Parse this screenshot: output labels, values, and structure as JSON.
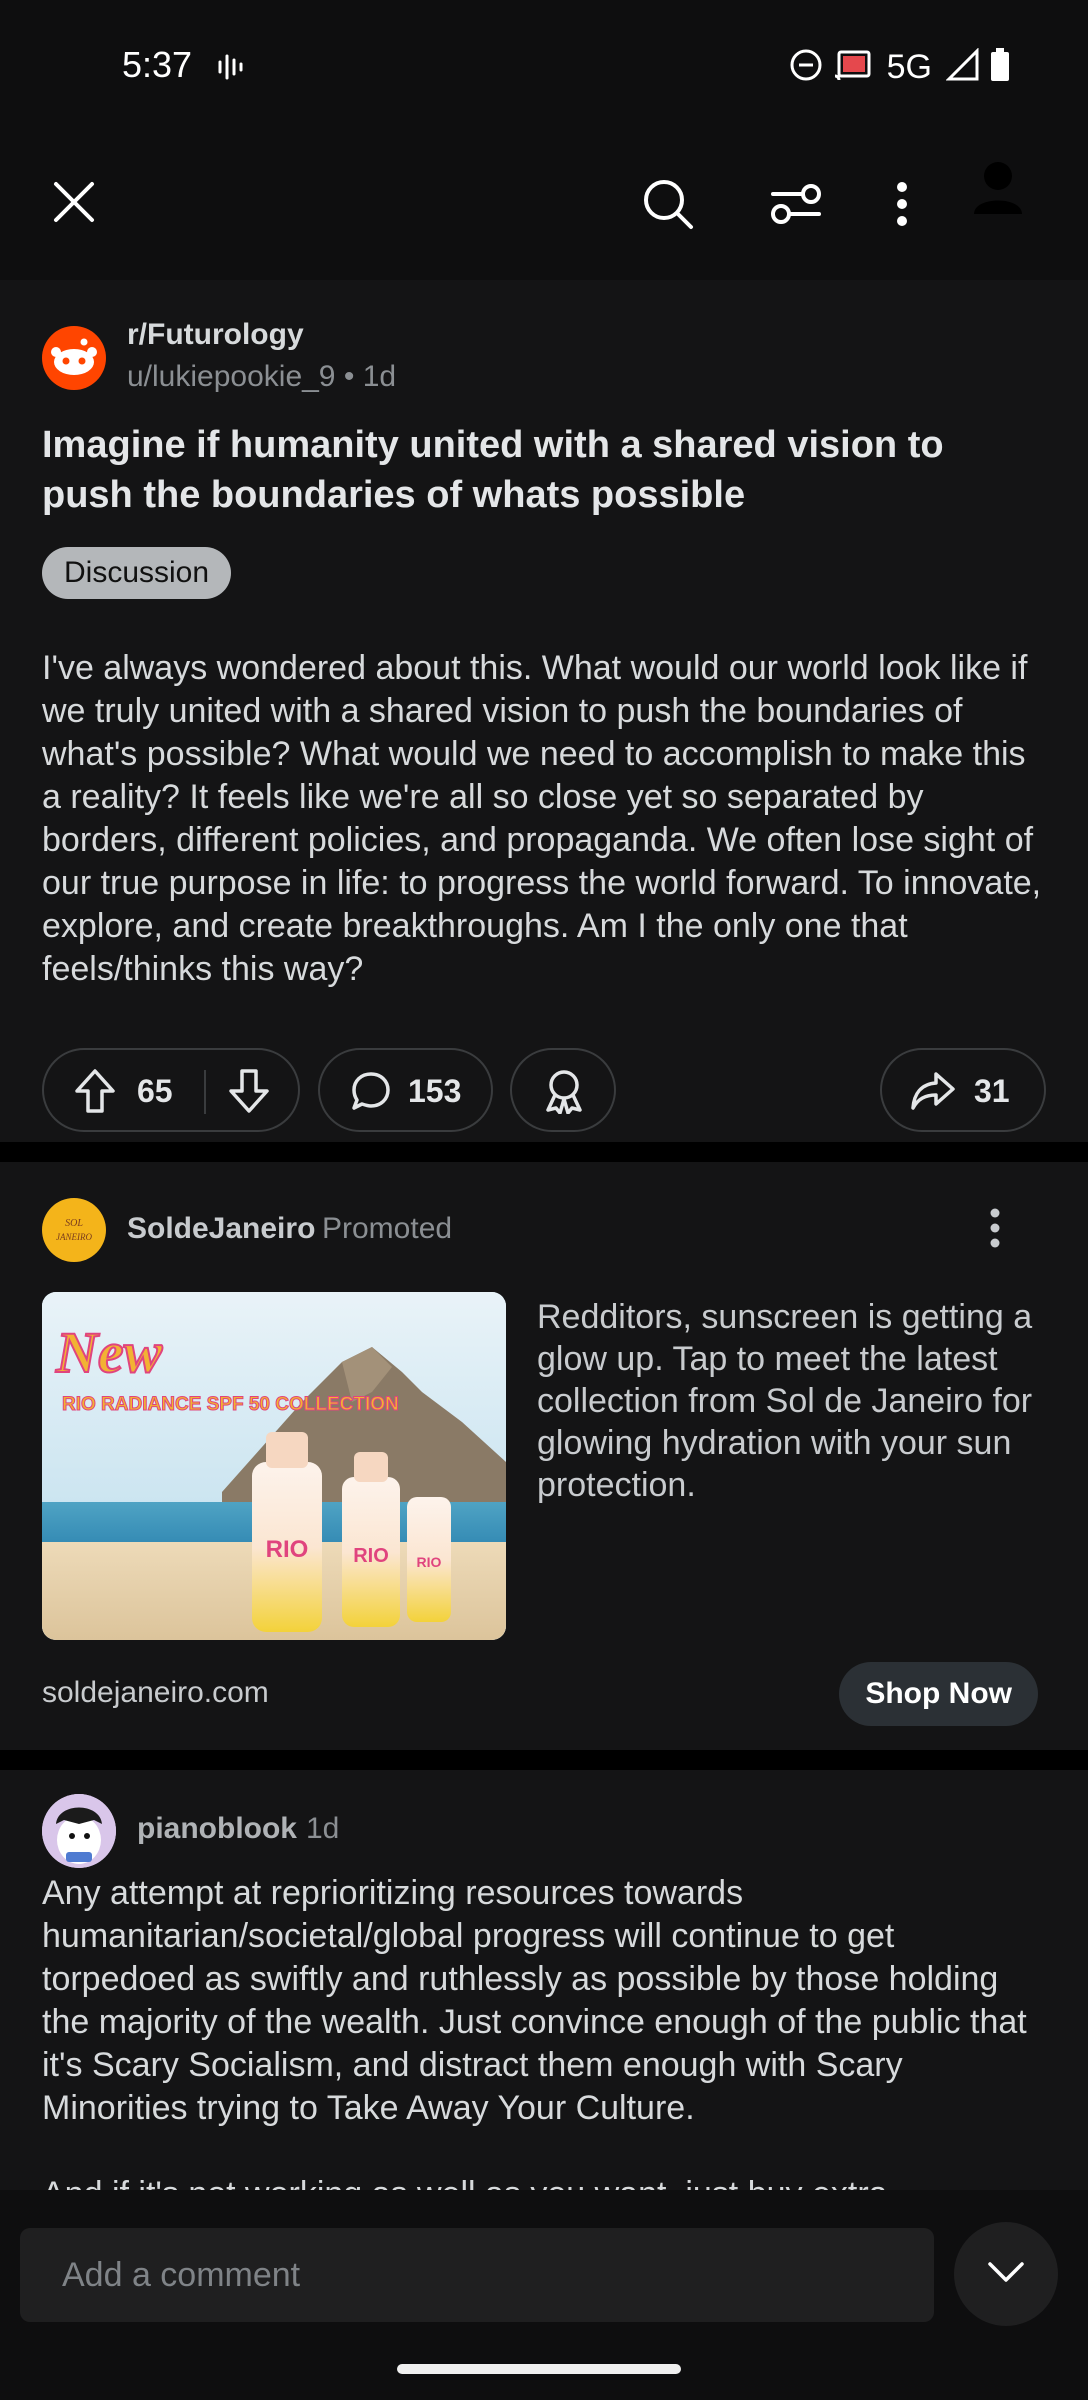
{
  "status_bar": {
    "time": "5:37",
    "network": "5G"
  },
  "post": {
    "subreddit": "r/Futurology",
    "author": "u/lukiepookie_9",
    "age": "1d",
    "title": "Imagine if humanity united with a shared vision to push the boundaries of whats possible",
    "flair": "Discussion",
    "body": "I've always wondered about this. What would our world look like if we truly united with a shared vision to push the boundaries of what's possible? What would we need to accomplish to make this a reality? It feels like we're all so close yet so separated by borders, different policies, and propaganda. We often lose sight of our true purpose in life: to progress the world forward. To innovate, explore, and create breakthroughs. Am I the only one that feels/thinks this way?",
    "upvotes": "65",
    "comments": "153",
    "shares": "31"
  },
  "ad": {
    "brand": "SoldeJaneiro",
    "promoted": "Promoted",
    "text": "Redditors, sunscreen is getting a glow up. Tap to meet the latest collection from Sol de Janeiro for glowing hydration with your sun protection.",
    "image_heading": "New",
    "image_subheading": "RIO RADIANCE SPF 50 COLLECTION",
    "domain": "soldejaneiro.com",
    "cta": "Shop Now"
  },
  "comment": {
    "author": "pianoblook",
    "age": "1d",
    "paragraph1": "Any attempt at reprioritizing resources towards humanitarian/societal/global progress will continue to get torpedoed as swiftly and ruthlessly as possible by those holding the majority of the wealth. Just convince enough of the public that it's Scary Socialism, and distract them enough with Scary Minorities trying to Take Away Your Culture.",
    "paragraph2": "And if it's not working as well as you want, just buy extra"
  },
  "comment_bar": {
    "placeholder": "Add a comment"
  },
  "icons": {
    "close": "close-icon",
    "search": "search-icon",
    "filter": "sort-filter-icon",
    "more": "more-vertical-icon",
    "profile": "profile-icon",
    "upvote": "upvote-icon",
    "downvote": "downvote-icon",
    "comment": "comment-icon",
    "award": "award-icon",
    "share": "share-icon",
    "collapse": "chevron-down-icon"
  },
  "colors": {
    "background": "#0e0e0f",
    "card": "#141415",
    "reddit_orange": "#ff4500",
    "flair": "#b4b7ba"
  }
}
